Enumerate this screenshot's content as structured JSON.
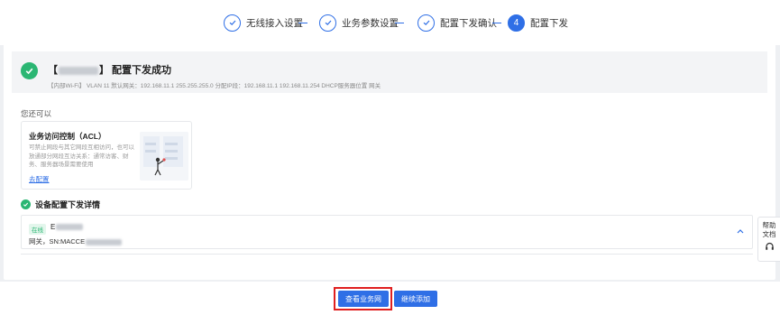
{
  "steps": [
    {
      "label": "无线接入设置",
      "icon": "check-icon"
    },
    {
      "label": "业务参数设置",
      "icon": "check-icon"
    },
    {
      "label": "配置下发确认",
      "icon": "check-icon"
    },
    {
      "label": "配置下发",
      "number": "4"
    }
  ],
  "success": {
    "title_prefix": "【",
    "title_suffix": "】 配置下发成功",
    "subtitle": "【内部Wi-Fi】 VLAN 11  默认网关：192.168.11.1 255.255.255.0  分配IP段：192.168.11.1 192.168.11.254  DHCP服务器位置 网关"
  },
  "also_label": "您还可以",
  "acl": {
    "title": "业务访问控制（ACL）",
    "desc": "可禁止网段与其它网段互相访问，也可以放通部分网段互访关系：通常访客、财务、服务器场景需要使用",
    "link": "去配置"
  },
  "detail": {
    "title": "设备配置下发详情",
    "device": {
      "status": "在线",
      "name": "E",
      "sn": "网关，SN:MACCE"
    }
  },
  "help": {
    "line1": "帮助",
    "line2": "文档"
  },
  "buttons": {
    "view": "查看业务网",
    "continue": "继续添加"
  },
  "colors": {
    "primary": "#2f6fe6",
    "success": "#2bb673",
    "highlight": "#e02020"
  }
}
